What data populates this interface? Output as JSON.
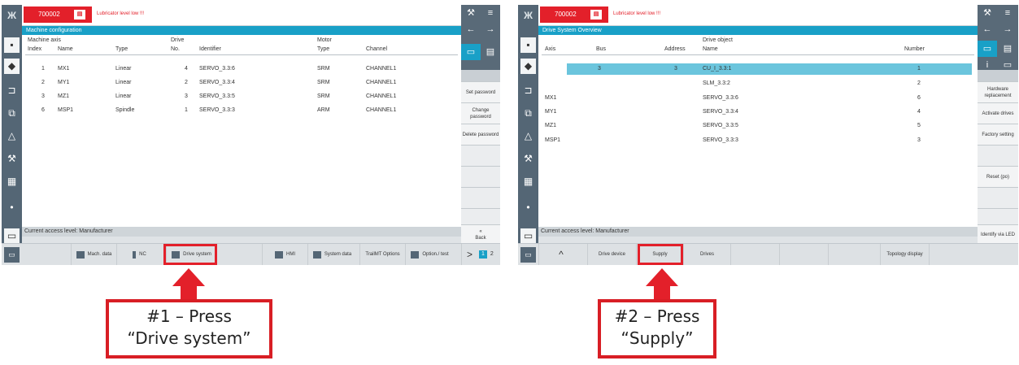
{
  "colors": {
    "alarm": "#e3202a",
    "title_bar": "#19a0c7",
    "sidebar": "#546675",
    "highlight": "#e3202a"
  },
  "left": {
    "alarm_number": "700002",
    "alarm_text": "Lubricator level low !!!",
    "title": "Machine configuration",
    "headers": {
      "group_axis": "Machine axis",
      "group_drive": "Drive",
      "group_motor": "Motor",
      "index": "Index",
      "name": "Name",
      "type": "Type",
      "no": "No.",
      "identifier": "Identifier",
      "motor_type": "Type",
      "channel": "Channel"
    },
    "rows": [
      {
        "index": "1",
        "name": "MX1",
        "type": "Linear",
        "no": "4",
        "identifier": "SERVO_3.3:6",
        "motor_type": "SRM",
        "channel": "CHANNEL1"
      },
      {
        "index": "2",
        "name": "MY1",
        "type": "Linear",
        "no": "2",
        "identifier": "SERVO_3.3:4",
        "motor_type": "SRM",
        "channel": "CHANNEL1"
      },
      {
        "index": "3",
        "name": "MZ1",
        "type": "Linear",
        "no": "3",
        "identifier": "SERVO_3.3:5",
        "motor_type": "SRM",
        "channel": "CHANNEL1"
      },
      {
        "index": "6",
        "name": "MSP1",
        "type": "Spindle",
        "no": "1",
        "identifier": "SERVO_3.3:3",
        "motor_type": "ARM",
        "channel": "CHANNEL1"
      }
    ],
    "access_level": "Current access level: Manufacturer",
    "right_buttons": [
      "Set password",
      "Change password",
      "Delete password"
    ],
    "back_symbol": "«",
    "back_label": "Back",
    "softkeys": [
      "Mach. data",
      "NC",
      "Drive system",
      "HMI",
      "System data",
      "TrailMT Options",
      "Option./ test"
    ],
    "page_next": ">",
    "page_1": "1",
    "page_2": "2",
    "callout_line1": "#1 – Press",
    "callout_line2": "“Drive system”"
  },
  "right": {
    "alarm_number": "700002",
    "alarm_text": "Lubricator level low !!!",
    "title": "Drive System Overview",
    "headers": {
      "group_drive_object": "Drive object",
      "axis": "Axis",
      "bus": "Bus",
      "address": "Address",
      "name": "Name",
      "number": "Number"
    },
    "rows": [
      {
        "axis": "",
        "bus": "3",
        "address": "3",
        "name": "CU_I_3.3:1",
        "number": "1",
        "selected": true
      },
      {
        "axis": "",
        "bus": "",
        "address": "",
        "name": "SLM_3.3:2",
        "number": "2",
        "selected": false
      },
      {
        "axis": "MX1",
        "bus": "",
        "address": "",
        "name": "SERVO_3.3:6",
        "number": "6",
        "selected": false
      },
      {
        "axis": "MY1",
        "bus": "",
        "address": "",
        "name": "SERVO_3.3:4",
        "number": "4",
        "selected": false
      },
      {
        "axis": "MZ1",
        "bus": "",
        "address": "",
        "name": "SERVO_3.3:5",
        "number": "5",
        "selected": false
      },
      {
        "axis": "MSP1",
        "bus": "",
        "address": "",
        "name": "SERVO_3.3:3",
        "number": "3",
        "selected": false
      }
    ],
    "access_level": "Current access level: Manufacturer",
    "right_buttons": [
      "Hardware replacement",
      "Activate drives",
      "Factory setting",
      "",
      "Reset (po)",
      "",
      "",
      "Identify via LED"
    ],
    "softkeys": [
      "Drive device",
      "Supply",
      "Drives",
      "",
      "",
      "",
      "Topology display"
    ],
    "up_symbol": "^",
    "callout_line1": "#2 – Press",
    "callout_line2": "“Supply”"
  }
}
